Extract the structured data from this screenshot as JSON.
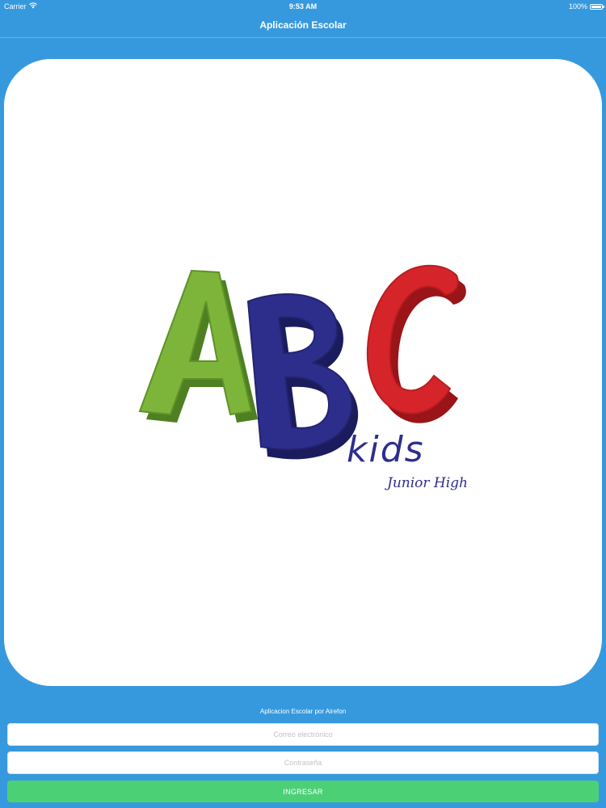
{
  "status_bar": {
    "carrier": "Carrier",
    "time": "9:53 AM",
    "battery": "100%",
    "battery_level": 1.0,
    "icons": [
      "wifi-icon",
      "battery-icon"
    ]
  },
  "nav": {
    "title": "Aplicación Escolar"
  },
  "logo": {
    "letters": [
      "A",
      "B",
      "C"
    ],
    "word": "kids",
    "tagline": "Junior High",
    "colors": {
      "a": "#7db43a",
      "b": "#2d2e8c",
      "c": "#d6252a"
    }
  },
  "form": {
    "credit": "Aplicacion Escolar por Airefon",
    "email_placeholder": "Correo electrónico",
    "password_placeholder": "Contraseña",
    "submit_label": "INGRESAR"
  },
  "colors": {
    "background": "#3799dd",
    "button": "#4cd076",
    "card": "#ffffff"
  }
}
